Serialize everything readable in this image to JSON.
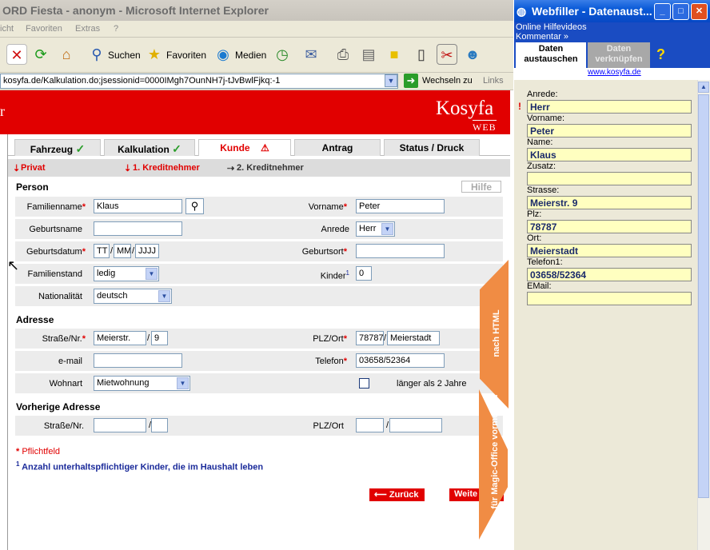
{
  "ie": {
    "title": "ORD Fiesta - anonym - Microsoft Internet Explorer",
    "menu": [
      "icht",
      "Favoriten",
      "Extras",
      "?"
    ],
    "toolbar": {
      "search": "Suchen",
      "favorites": "Favoriten",
      "media": "Medien"
    },
    "address": "kosyfa.de/Kalkulation.do;jsessionid=0000IMgh7OunNH7j-tJvBwlFjkq:-1",
    "go": "Wechseln zu",
    "links": "Links"
  },
  "site": {
    "brand_left": "r",
    "logo": "Kosyfa",
    "logo_sub": "WEB"
  },
  "tabs": [
    {
      "label": "Fahrzeug",
      "status": "✓"
    },
    {
      "label": "Kalkulation",
      "status": "✓"
    },
    {
      "label": "Kunde",
      "status": "⚠"
    },
    {
      "label": "Antrag",
      "status": ""
    },
    {
      "label": "Status / Druck",
      "status": ""
    }
  ],
  "subnav": {
    "privat": "Privat",
    "k1": "1. Kreditnehmer",
    "k2": "2. Kreditnehmer"
  },
  "person": {
    "section": "Person",
    "help": "Hilfe",
    "familienname_label": "Familienname",
    "familienname": "Klaus",
    "vorname_label": "Vorname",
    "vorname": "Peter",
    "geburtsname_label": "Geburtsname",
    "geburtsname": "",
    "anrede_label": "Anrede",
    "anrede": "Herr",
    "geburtsdatum_label": "Geburtsdatum",
    "gd_tt": "TT",
    "gd_mm": "MM",
    "gd_jjjj": "JJJJ",
    "geburtsort_label": "Geburtsort",
    "geburtsort": "",
    "familienstand_label": "Familienstand",
    "familienstand": "ledig",
    "kinder_label": "Kinder",
    "kinder_sup": "1",
    "kinder": "0",
    "nationalitaet_label": "Nationalität",
    "nationalitaet": "deutsch"
  },
  "adresse": {
    "section": "Adresse",
    "strasse_label": "Straße/Nr.",
    "strasse": "Meierstr.",
    "nr": "9",
    "plzort_label": "PLZ/Ort",
    "plz": "78787",
    "ort": "Meierstadt",
    "email_label": "e-mail",
    "email": "",
    "telefon_label": "Telefon",
    "telefon": "03658/52364",
    "wohnart_label": "Wohnart",
    "wohnart": "Mietwohnung",
    "laenger_label": "länger als 2 Jahre"
  },
  "vorherige": {
    "section": "Vorherige Adresse",
    "strasse_label": "Straße/Nr.",
    "plzort_label": "PLZ/Ort"
  },
  "footnotes": {
    "pflicht": "Pflichtfeld",
    "kinder_sup": "1",
    "kinder_note": "Anzahl unterhaltspflichtiger Kinder, die im Haushalt leben"
  },
  "buttons": {
    "zurueck": "Zurück",
    "weiter": "Weite"
  },
  "side_tabs": {
    "html": "nach HTML",
    "magic": "für Magic-Office vormerken"
  },
  "webfiller": {
    "title": "Webfiller - Datenaust...",
    "link1": "Online Hilfevideos",
    "link2": "Kommentar »",
    "tab1": "Daten austauschen",
    "tab2": "Daten verknüpfen",
    "site": "www.kosyfa.de",
    "fields": [
      {
        "label": "Anrede:",
        "value": "Herr"
      },
      {
        "label": "Vorname:",
        "value": "Peter"
      },
      {
        "label": "Name:",
        "value": "Klaus"
      },
      {
        "label": "Zusatz:",
        "value": ""
      },
      {
        "label": "Strasse:",
        "value": "Meierstr. 9"
      },
      {
        "label": "Plz:",
        "value": "78787"
      },
      {
        "label": "Ort:",
        "value": "Meierstadt"
      },
      {
        "label": "Telefon1:",
        "value": "03658/52364"
      },
      {
        "label": "EMail:",
        "value": ""
      }
    ]
  },
  "colors": {
    "brand_red": "#e10000",
    "wf_blue": "#1a4cc2",
    "field_yellow": "#ffffc0",
    "side_orange": "#f08c44"
  }
}
